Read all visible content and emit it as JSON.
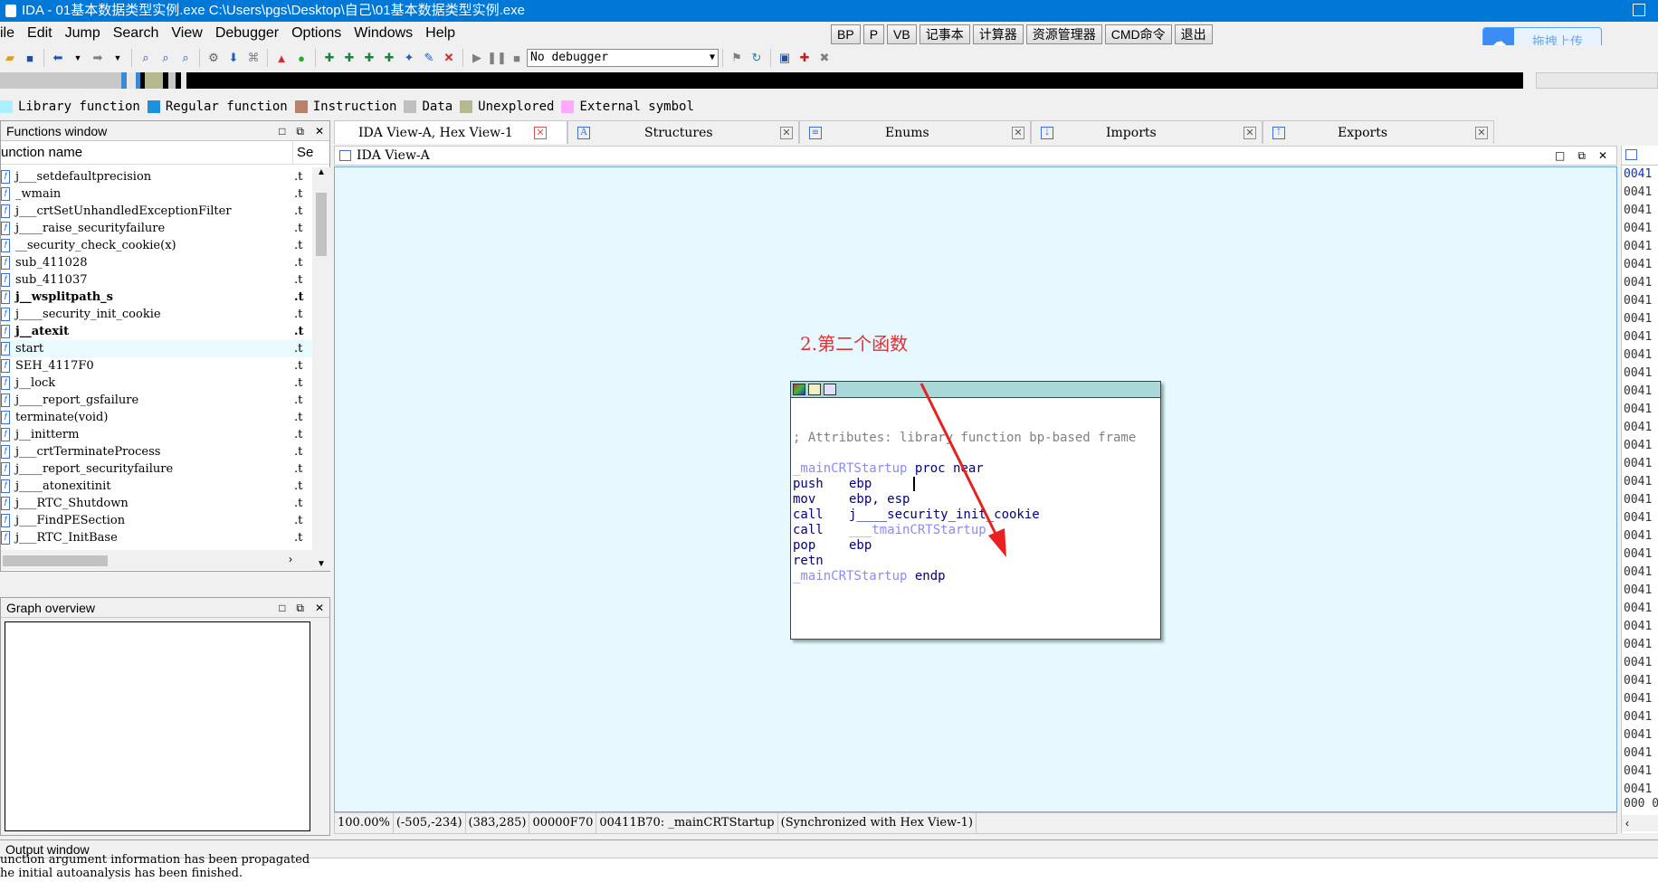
{
  "titlebar": {
    "title": "IDA - 01基本数据类型实例.exe C:\\Users\\pgs\\Desktop\\自己\\01基本数据类型实例.exe"
  },
  "menu": [
    "ile",
    "Edit",
    "Jump",
    "Search",
    "View",
    "Debugger",
    "Options",
    "Windows",
    "Help"
  ],
  "quick_buttons": [
    "BP",
    "P",
    "VB",
    "记事本",
    "计算器",
    "资源管理器",
    "CMD命令",
    "退出"
  ],
  "cloud": {
    "label": "拖拽上传"
  },
  "toolbar": {
    "debugger_select": "No debugger"
  },
  "legend": [
    {
      "label": "Library function",
      "color": "#aaf0ff"
    },
    {
      "label": "Regular function",
      "color": "#1e90e0"
    },
    {
      "label": "Instruction",
      "color": "#b8826a"
    },
    {
      "label": "Data",
      "color": "#c0c0c0"
    },
    {
      "label": "Unexplored",
      "color": "#b8b890"
    },
    {
      "label": "External symbol",
      "color": "#ffa8ff"
    }
  ],
  "functions_window": {
    "title": "Functions window",
    "col_name": "unction name",
    "col_seg": "Se",
    "rows": [
      {
        "name": "j___setdefaultprecision",
        "seg": ".t"
      },
      {
        "name": "_wmain",
        "seg": ".t"
      },
      {
        "name": "j___crtSetUnhandledExceptionFilter",
        "seg": ".t"
      },
      {
        "name": "j____raise_securityfailure",
        "seg": ".t"
      },
      {
        "name": "__security_check_cookie(x)",
        "seg": ".t"
      },
      {
        "name": "sub_411028",
        "seg": ".t"
      },
      {
        "name": "sub_411037",
        "seg": ".t"
      },
      {
        "name": "j__wsplitpath_s",
        "seg": ".t"
      },
      {
        "name": "j____security_init_cookie",
        "seg": ".t"
      },
      {
        "name": "j__atexit",
        "seg": ".t"
      },
      {
        "name": "start",
        "seg": ".t"
      },
      {
        "name": "SEH_4117F0",
        "seg": ".t"
      },
      {
        "name": "j__lock",
        "seg": ".t"
      },
      {
        "name": "j____report_gsfailure",
        "seg": ".t"
      },
      {
        "name": "terminate(void)",
        "seg": ".t"
      },
      {
        "name": "j__initterm",
        "seg": ".t"
      },
      {
        "name": "j___crtTerminateProcess",
        "seg": ".t"
      },
      {
        "name": "j____report_securityfailure",
        "seg": ".t"
      },
      {
        "name": "j____atonexitinit",
        "seg": ".t"
      },
      {
        "name": "j___RTC_Shutdown",
        "seg": ".t"
      },
      {
        "name": "j___FindPESection",
        "seg": ".t"
      },
      {
        "name": "j___RTC_InitBase",
        "seg": ".t"
      }
    ]
  },
  "graph_overview": {
    "title": "Graph overview"
  },
  "tabs": [
    {
      "label": "IDA View-A, Hex View-1"
    },
    {
      "label": "Structures"
    },
    {
      "label": "Enums"
    },
    {
      "label": "Imports"
    },
    {
      "label": "Exports"
    }
  ],
  "ida_view": {
    "title": "IDA View-A",
    "annotation": "2.第二个函数",
    "code": {
      "comment": "; Attributes: library function bp-based frame",
      "proc_label": "_mainCRTStartup",
      "proc_kw": "proc near",
      "lines": [
        {
          "mn": "push",
          "op": "ebp"
        },
        {
          "mn": "mov",
          "op": "ebp, esp"
        },
        {
          "mn": "call",
          "op": "j____security_init_cookie"
        },
        {
          "mn": "call",
          "op": "___tmainCRTStartup"
        },
        {
          "mn": "pop",
          "op": "ebp"
        },
        {
          "mn": "retn",
          "op": ""
        }
      ],
      "endp_label": "_mainCRTStartup",
      "endp_kw": "endp"
    }
  },
  "statusbar": [
    "100.00%",
    "(-505,-234)",
    "(383,285)",
    "00000F70",
    "00411B70: _mainCRTStartup",
    "(Synchronized with Hex View-1)"
  ],
  "hex_panel": {
    "addr": "0041",
    "bottom": "000 0"
  },
  "output_window": {
    "title": "Output window",
    "lines": [
      "unction argument information has been propagated",
      "he initial autoanalysis has been finished."
    ]
  }
}
